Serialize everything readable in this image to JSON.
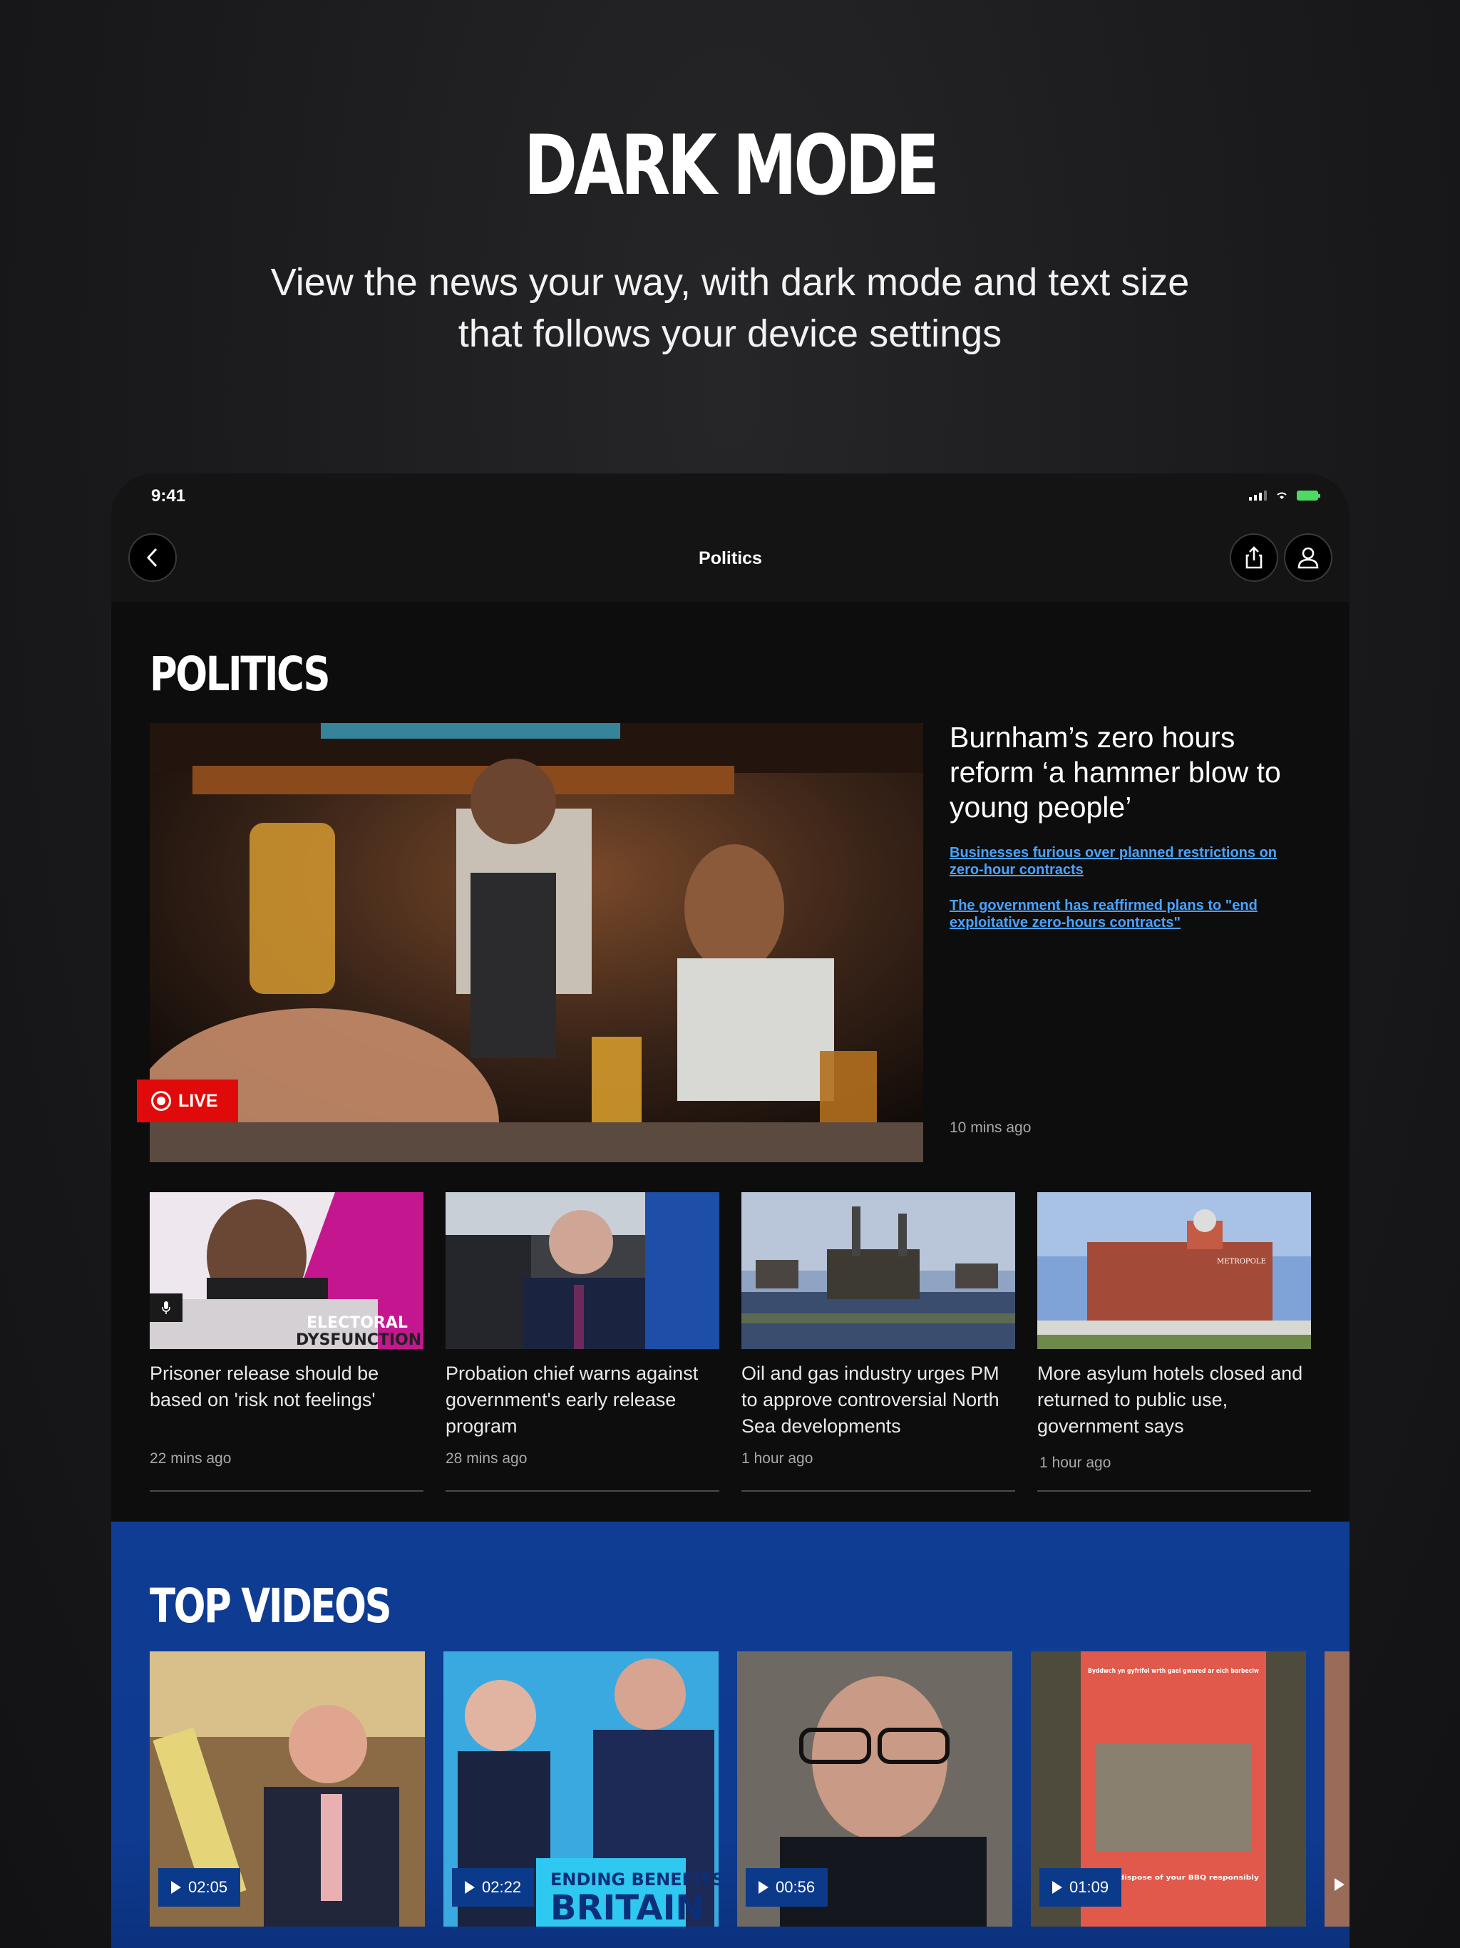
{
  "promo": {
    "title": "DARK MODE",
    "subtitle": "View the news your way, with dark mode and text size that follows your device settings"
  },
  "status_bar": {
    "time": "9:41"
  },
  "nav": {
    "title": "Politics"
  },
  "politics": {
    "section_title": "POLITICS",
    "hero": {
      "badge": "LIVE",
      "headline": "Burnham’s zero hours reform ‘a hammer blow to young people’",
      "links": [
        "Businesses furious over planned restrictions on zero-hour contracts",
        "The government has reaffirmed plans to \"end exploitative zero-hours contracts\""
      ],
      "time": "10 mins ago"
    },
    "cards": [
      {
        "title": "Prisoner release should be based on 'risk not feelings'",
        "time": "22 mins ago",
        "image_text": [
          "ELECTORAL",
          "DYSFUNCTION"
        ]
      },
      {
        "title": "Probation chief warns against government's early release program",
        "time": "28 mins ago"
      },
      {
        "title": "Oil and gas industry urges PM to approve controversial North Sea developments",
        "time": "1 hour ago"
      },
      {
        "title": "More asylum hotels closed and returned to public use, government says",
        "time": "1 hour ago",
        "image_text": [
          "METROPOLE"
        ]
      }
    ]
  },
  "top_videos": {
    "section_title": "TOP VIDEOS",
    "videos": [
      {
        "duration": "02:05"
      },
      {
        "duration": "02:22",
        "image_text": [
          "ENDING BENEFITS",
          "BRITAIN"
        ]
      },
      {
        "duration": "00:56"
      },
      {
        "duration": "01:09",
        "image_text": [
          "Byddwch yn gyfrifol wrth gael gwared ar eich barbeciw",
          "Please dispose of your BBQ responsibly"
        ]
      }
    ]
  },
  "colors": {
    "accent_blue": "#0f3d94",
    "live_red": "#e10a0a",
    "link_blue": "#4aa3ff"
  }
}
